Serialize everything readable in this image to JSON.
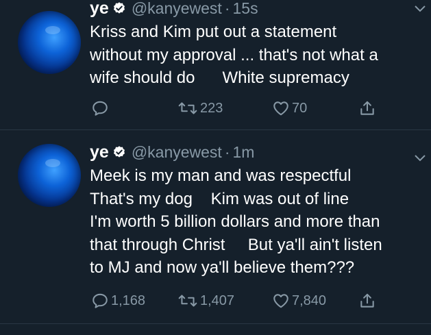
{
  "tweets": [
    {
      "name": "ye",
      "handle": "@kanyewest",
      "separator": "·",
      "time": "15s",
      "body": "Kriss and Kim put out a statement\nwithout my approval ... that's not what a\nwife should do      White supremacy",
      "replies": "",
      "retweets": "223",
      "likes": "70"
    },
    {
      "name": "ye",
      "handle": "@kanyewest",
      "separator": "·",
      "time": "1m",
      "body": "Meek is my man and was respectful\nThat's my dog    Kim was out of line\nI'm worth 5 billion dollars and more than\nthat through Christ     But ya'll ain't listen\nto MJ and now ya'll believe them???",
      "replies": "1,168",
      "retweets": "1,407",
      "likes": "7,840"
    }
  ],
  "icons": {
    "reply": "reply-icon",
    "retweet": "retweet-icon",
    "like": "heart-icon",
    "share": "share-icon",
    "verified": "verified-badge-icon",
    "caret": "chevron-down-icon"
  },
  "colors": {
    "background": "#15202b",
    "text": "#ffffff",
    "muted": "#8899a6",
    "divider": "#2a3744"
  }
}
